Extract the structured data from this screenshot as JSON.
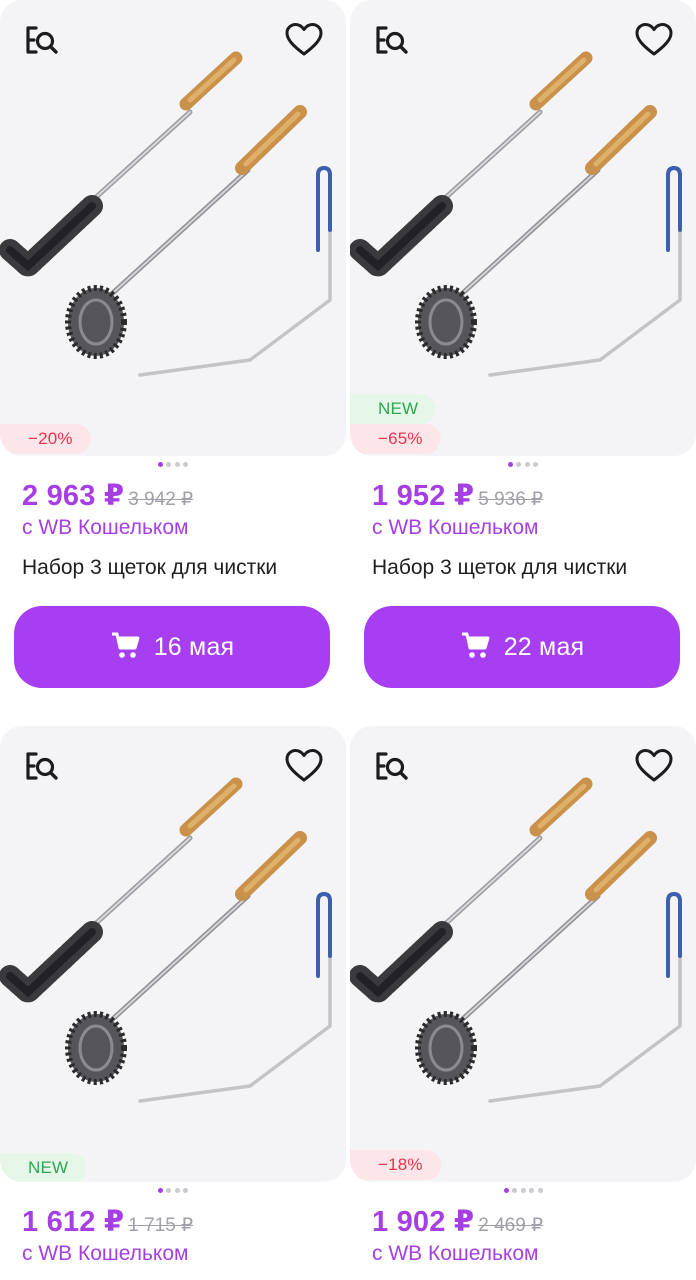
{
  "colors": {
    "accent": "#a63fe3",
    "button": "#a73ef1",
    "discount": "#e0354c",
    "new": "#2aa84f"
  },
  "icons": {
    "search": "image-search-icon",
    "favorite": "heart-icon",
    "cart": "cart-icon"
  },
  "products": [
    {
      "badges": [
        {
          "type": "discount",
          "text": "−20%"
        }
      ],
      "image_count": 4,
      "active_image": 0,
      "price": "2 963 ₽",
      "old_price": "3 942 ₽",
      "wallet": "с WB Кошельком",
      "title": "Набор 3 щеток для чистки",
      "delivery": "16 мая"
    },
    {
      "badges": [
        {
          "type": "new",
          "text": "NEW"
        },
        {
          "type": "discount",
          "text": "−65%"
        }
      ],
      "image_count": 4,
      "active_image": 0,
      "price": "1 952 ₽",
      "old_price": "5 936 ₽",
      "wallet": "с WB Кошельком",
      "title": "Набор 3 щеток для чистки",
      "delivery": "22 мая"
    },
    {
      "badges": [
        {
          "type": "new",
          "text": "NEW"
        }
      ],
      "image_count": 4,
      "active_image": 0,
      "price": "1 612 ₽",
      "old_price": "1 715 ₽",
      "wallet": "с WB Кошельком"
    },
    {
      "badges": [
        {
          "type": "discount",
          "text": "−18%"
        }
      ],
      "image_count": 5,
      "active_image": 0,
      "price": "1 902 ₽",
      "old_price": "2 469 ₽",
      "wallet": "с WB Кошельком"
    }
  ]
}
